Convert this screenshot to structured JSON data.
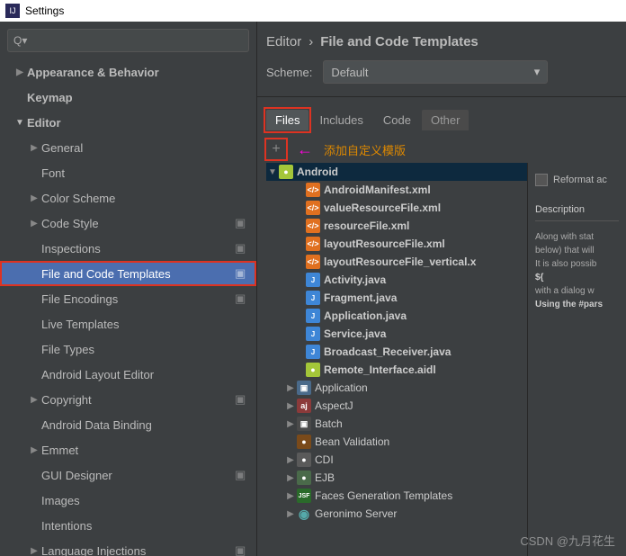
{
  "titlebar": {
    "title": "Settings"
  },
  "breadcrumb": {
    "root": "Editor",
    "leaf": "File and Code Templates"
  },
  "scheme": {
    "label": "Scheme:",
    "value": "Default"
  },
  "tabs": [
    {
      "label": "Files",
      "active": true,
      "hl": true
    },
    {
      "label": "Includes"
    },
    {
      "label": "Code"
    },
    {
      "label": "Other",
      "other": true
    }
  ],
  "annotation": {
    "text": "添加自定义模版"
  },
  "sidebar": [
    {
      "label": "Appearance & Behavior",
      "depth": 0,
      "bold": true,
      "arrow": "right"
    },
    {
      "label": "Keymap",
      "depth": 0,
      "bold": true
    },
    {
      "label": "Editor",
      "depth": 0,
      "bold": true,
      "arrow": "down"
    },
    {
      "label": "General",
      "depth": 1,
      "arrow": "right"
    },
    {
      "label": "Font",
      "depth": 1
    },
    {
      "label": "Color Scheme",
      "depth": 1,
      "arrow": "right"
    },
    {
      "label": "Code Style",
      "depth": 1,
      "arrow": "right",
      "badge": true
    },
    {
      "label": "Inspections",
      "depth": 1,
      "badge": true
    },
    {
      "label": "File and Code Templates",
      "depth": 1,
      "badge": true,
      "selected": true,
      "hl": true
    },
    {
      "label": "File Encodings",
      "depth": 1,
      "badge": true
    },
    {
      "label": "Live Templates",
      "depth": 1
    },
    {
      "label": "File Types",
      "depth": 1
    },
    {
      "label": "Android Layout Editor",
      "depth": 1
    },
    {
      "label": "Copyright",
      "depth": 1,
      "arrow": "right",
      "badge": true
    },
    {
      "label": "Android Data Binding",
      "depth": 1
    },
    {
      "label": "Emmet",
      "depth": 1,
      "arrow": "right"
    },
    {
      "label": "GUI Designer",
      "depth": 1,
      "badge": true
    },
    {
      "label": "Images",
      "depth": 1
    },
    {
      "label": "Intentions",
      "depth": 1
    },
    {
      "label": "Language Injections",
      "depth": 1,
      "arrow": "right",
      "badge": true
    }
  ],
  "ftree": [
    {
      "label": "Android",
      "depth": 0,
      "arrow": "down",
      "icon": "android",
      "sel": true
    },
    {
      "label": "AndroidManifest.xml",
      "depth": 2,
      "icon": "xml"
    },
    {
      "label": "valueResourceFile.xml",
      "depth": 2,
      "icon": "xml"
    },
    {
      "label": "resourceFile.xml",
      "depth": 2,
      "icon": "xml"
    },
    {
      "label": "layoutResourceFile.xml",
      "depth": 2,
      "icon": "xml"
    },
    {
      "label": "layoutResourceFile_vertical.x",
      "depth": 2,
      "icon": "xml"
    },
    {
      "label": "Activity.java",
      "depth": 2,
      "icon": "java"
    },
    {
      "label": "Fragment.java",
      "depth": 2,
      "icon": "java"
    },
    {
      "label": "Application.java",
      "depth": 2,
      "icon": "java"
    },
    {
      "label": "Service.java",
      "depth": 2,
      "icon": "java"
    },
    {
      "label": "Broadcast_Receiver.java",
      "depth": 2,
      "icon": "java"
    },
    {
      "label": "Remote_Interface.aidl",
      "depth": 2,
      "icon": "aidl"
    },
    {
      "label": "Application",
      "depth": 1,
      "arrow": "right",
      "icon": "folder"
    },
    {
      "label": "AspectJ",
      "depth": 1,
      "arrow": "right",
      "icon": "aj"
    },
    {
      "label": "Batch",
      "depth": 1,
      "arrow": "right",
      "icon": "batch"
    },
    {
      "label": "Bean Validation",
      "depth": 1,
      "icon": "bean"
    },
    {
      "label": "CDI",
      "depth": 1,
      "arrow": "right",
      "icon": "cdi"
    },
    {
      "label": "EJB",
      "depth": 1,
      "arrow": "right",
      "icon": "ejb"
    },
    {
      "label": "Faces Generation Templates",
      "depth": 1,
      "arrow": "right",
      "icon": "jsf"
    },
    {
      "label": "Geronimo Server",
      "depth": 1,
      "arrow": "right",
      "icon": "globe"
    }
  ],
  "right": {
    "reformat": "Reformat ac",
    "descTitle": "Description",
    "descBody": [
      "Along with stat",
      "below) that will",
      "It is also possib",
      "${<VARIABLE",
      "with a dialog w",
      "Using the #pars"
    ]
  },
  "watermark": "CSDN @九月花生"
}
